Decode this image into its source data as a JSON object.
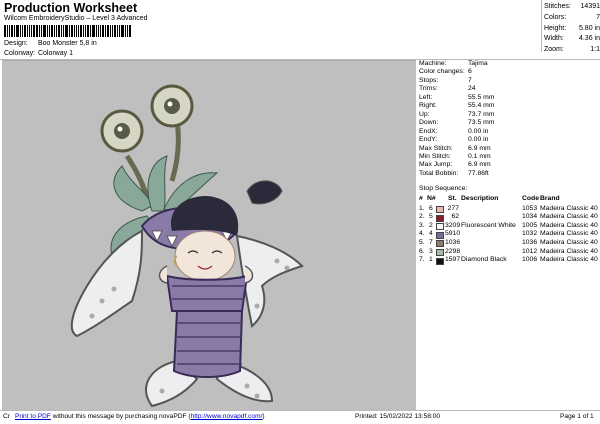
{
  "header": {
    "title": "Production Worksheet",
    "subtitle": "Wilcom EmbroideryStudio – Level 3 Advanced"
  },
  "design_info": {
    "design_label": "Design:",
    "design_value": "Boo Monster 5,8 in",
    "colorway_label": "Colorway:",
    "colorway_value": "Colorway 1"
  },
  "stats": [
    {
      "label": "Stitches:",
      "value": "14391"
    },
    {
      "label": "Colors:",
      "value": "7"
    },
    {
      "label": "Height:",
      "value": "5.80 in"
    },
    {
      "label": "Width:",
      "value": "4.36 in"
    },
    {
      "label": "Zoom:",
      "value": "1:1"
    }
  ],
  "machine_info": [
    {
      "label": "Machine:",
      "value": "Tajima"
    },
    {
      "label": "Color changes:",
      "value": "6"
    },
    {
      "label": "Stops:",
      "value": "7"
    },
    {
      "label": "Trims:",
      "value": "24"
    },
    {
      "label": "Left:",
      "value": "55.5 mm"
    },
    {
      "label": "Right:",
      "value": "55.4 mm"
    },
    {
      "label": "Up:",
      "value": "73.7 mm"
    },
    {
      "label": "Down:",
      "value": "73.5 mm"
    },
    {
      "label": "EndX:",
      "value": "0.00 in"
    },
    {
      "label": "EndY:",
      "value": "0.00 in"
    },
    {
      "label": "Max Stitch:",
      "value": "6.9 mm"
    },
    {
      "label": "Min Stitch:",
      "value": "0.1 mm"
    },
    {
      "label": "Max Jump:",
      "value": "6.9 mm"
    },
    {
      "label": "Total Bobbin:",
      "value": "77.86ft"
    }
  ],
  "stop_sequence": {
    "title": "Stop Sequence:",
    "headers": {
      "num": "#",
      "n": "N#",
      "st": "St.",
      "desc": "Description",
      "code": "Code",
      "brand": "Brand"
    },
    "rows": [
      {
        "num": "1.",
        "n": "6",
        "st": "277",
        "desc": "",
        "code": "1053",
        "brand": "Madeira Classic 40",
        "color": "#e8b8a8"
      },
      {
        "num": "2.",
        "n": "5",
        "st": "62",
        "desc": "",
        "code": "1034",
        "brand": "Madeira Classic 40",
        "color": "#8a1c2c"
      },
      {
        "num": "3.",
        "n": "2",
        "st": "3209",
        "desc": "Fluorescent White",
        "code": "1005",
        "brand": "Madeira Classic 40",
        "color": "#f4f6fa"
      },
      {
        "num": "4.",
        "n": "4",
        "st": "5910",
        "desc": "",
        "code": "1032",
        "brand": "Madeira Classic 40",
        "color": "#7a6a9c"
      },
      {
        "num": "5.",
        "n": "7",
        "st": "1036",
        "desc": "",
        "code": "1036",
        "brand": "Madeira Classic 40",
        "color": "#8a7a6a"
      },
      {
        "num": "6.",
        "n": "3",
        "st": "2298",
        "desc": "",
        "code": "1012",
        "brand": "Madeira Classic 40",
        "color": "#a8b8a8"
      },
      {
        "num": "7.",
        "n": "1",
        "st": "1597",
        "desc": "Diamond Black",
        "code": "1006",
        "brand": "Madeira Classic 40",
        "color": "#111111"
      }
    ]
  },
  "footer": {
    "prefix": "Cr",
    "link1": "Print to PDF",
    "middle": " without this message by purchasing novaPDF (",
    "link2": "http://www.novapdf.com/",
    "suffix": ")",
    "printed": "Printed: 15/02/2022 13:58:00",
    "page": "Page 1 of 1"
  },
  "colors": {
    "design_bg": "#bfbfbf",
    "link": "#0000cc"
  }
}
